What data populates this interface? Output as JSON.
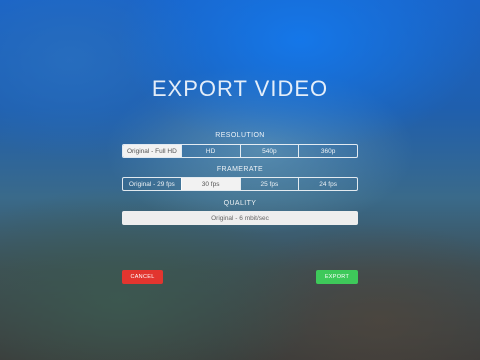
{
  "title": "EXPORT VIDEO",
  "resolution": {
    "label": "RESOLUTION",
    "options": [
      "Original - Full HD",
      "HD",
      "540p",
      "360p"
    ],
    "selected": "Original - Full HD"
  },
  "framerate": {
    "label": "FRAMERATE",
    "options": [
      "Original - 29 fps",
      "30 fps",
      "25 fps",
      "24 fps"
    ],
    "selected": "30 fps"
  },
  "quality": {
    "label": "QUALITY",
    "value": "Original - 6 mbit/sec"
  },
  "buttons": {
    "cancel": "CANCEL",
    "export": "EXPORT"
  },
  "colors": {
    "cancel": "#e2352f",
    "export": "#3ec95a",
    "selected_segment": "#f2f2f2"
  }
}
